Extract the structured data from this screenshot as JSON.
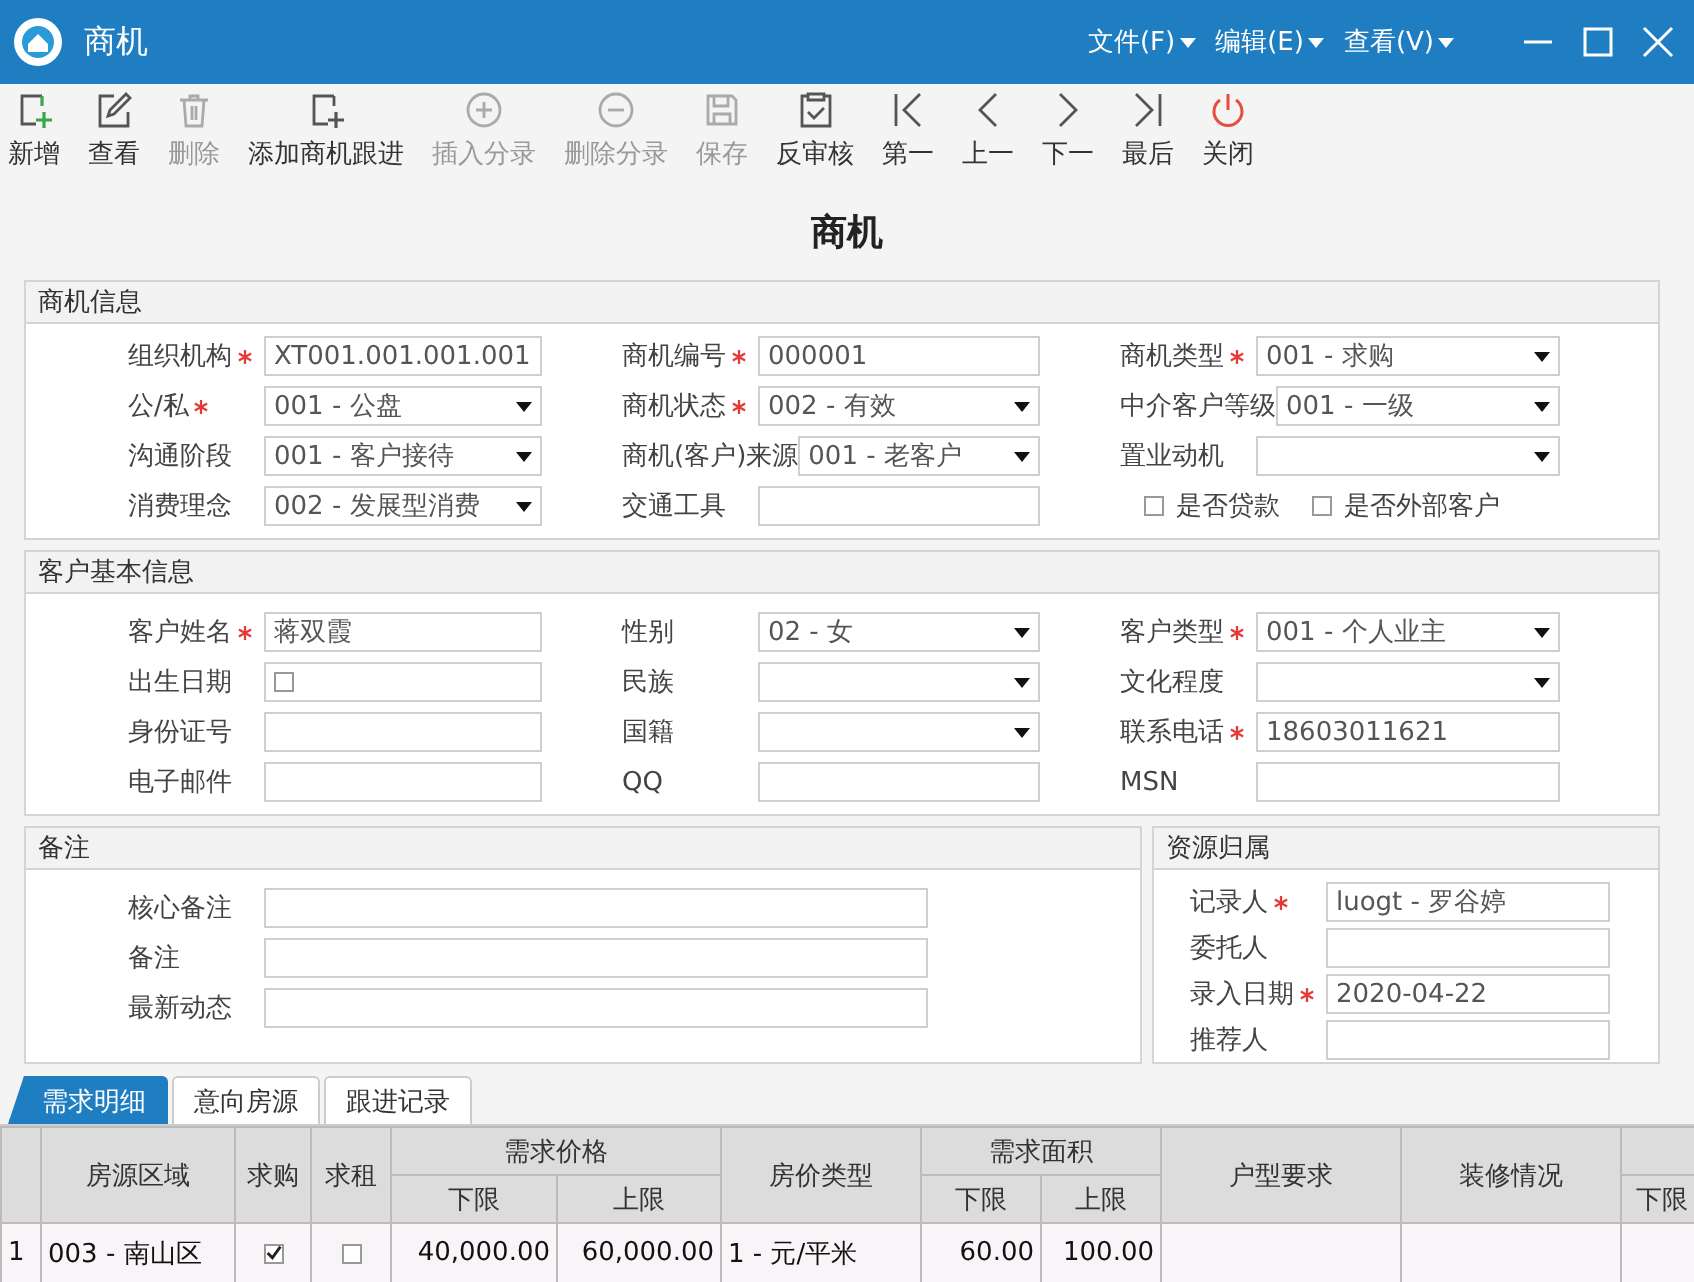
{
  "window": {
    "title": "商机",
    "menus": [
      "文件(F)",
      "编辑(E)",
      "查看(V)"
    ]
  },
  "toolbar": [
    {
      "label": "新增",
      "kind": "new",
      "disabled": false
    },
    {
      "label": "查看",
      "kind": "edit",
      "disabled": false
    },
    {
      "label": "删除",
      "kind": "delete",
      "disabled": true
    },
    {
      "label": "添加商机跟进",
      "kind": "add",
      "disabled": false
    },
    {
      "label": "插入分录",
      "kind": "insert",
      "disabled": true
    },
    {
      "label": "删除分录",
      "kind": "remove",
      "disabled": true
    },
    {
      "label": "保存",
      "kind": "save",
      "disabled": true
    },
    {
      "label": "反审核",
      "kind": "audit",
      "disabled": false
    },
    {
      "label": "第一",
      "kind": "first",
      "disabled": false
    },
    {
      "label": "上一",
      "kind": "prev",
      "disabled": false
    },
    {
      "label": "下一",
      "kind": "next",
      "disabled": false
    },
    {
      "label": "最后",
      "kind": "last",
      "disabled": false
    },
    {
      "label": "关闭",
      "kind": "close",
      "disabled": false
    }
  ],
  "heading": "商机",
  "sections": [
    {
      "title": "商机信息",
      "rows": [
        [
          {
            "kind": "text",
            "label": "组织机构",
            "required": true,
            "value": "XT001.001.001.001"
          },
          {
            "kind": "text",
            "label": "商机编号",
            "required": true,
            "value": "000001"
          },
          {
            "kind": "select",
            "label": "商机类型",
            "required": true,
            "value": "001 - 求购"
          }
        ],
        [
          {
            "kind": "select",
            "label": "公/私",
            "required": true,
            "value": "001 - 公盘"
          },
          {
            "kind": "select",
            "label": "商机状态",
            "required": true,
            "value": "002 - 有效"
          },
          {
            "kind": "select",
            "label": "中介客户等级",
            "required": false,
            "value": "001 - 一级"
          }
        ],
        [
          {
            "kind": "select",
            "label": "沟通阶段",
            "required": false,
            "value": "001 - 客户接待"
          },
          {
            "kind": "select",
            "label": "商机(客户)来源",
            "required": false,
            "value": "001 - 老客户"
          },
          {
            "kind": "select",
            "label": "置业动机",
            "required": false
          }
        ],
        [
          {
            "kind": "select",
            "label": "消费理念",
            "required": false,
            "value": "002 - 发展型消费"
          },
          {
            "kind": "text",
            "label": "交通工具",
            "required": false
          },
          {
            "kind": "checkgroup",
            "items": [
              {
                "label": "是否贷款",
                "checked": false
              },
              {
                "label": "是否外部客户",
                "checked": false
              }
            ]
          }
        ]
      ]
    },
    {
      "title": "客户基本信息",
      "rows": [
        [
          {
            "kind": "text",
            "label": "客户姓名",
            "required": true,
            "value": "蒋双霞"
          },
          {
            "kind": "select",
            "label": "性别",
            "required": false,
            "value": "02 - 女"
          },
          {
            "kind": "select",
            "label": "客户类型",
            "required": true,
            "value": "001 - 个人业主"
          }
        ],
        [
          {
            "kind": "date",
            "label": "出生日期",
            "required": false,
            "checked": false
          },
          {
            "kind": "select",
            "label": "民族",
            "required": false
          },
          {
            "kind": "select",
            "label": "文化程度",
            "required": false
          }
        ],
        [
          {
            "kind": "text",
            "label": "身份证号",
            "required": false
          },
          {
            "kind": "select",
            "label": "国籍",
            "required": false
          },
          {
            "kind": "text",
            "label": "联系电话",
            "required": true,
            "value": "18603011621"
          }
        ],
        [
          {
            "kind": "text",
            "label": "电子邮件",
            "required": false
          },
          {
            "kind": "text",
            "label": "QQ",
            "required": false
          },
          {
            "kind": "text",
            "label": "MSN",
            "required": false
          }
        ]
      ]
    },
    {
      "title": "备注",
      "rows": [
        [
          {
            "kind": "text",
            "label": "核心备注",
            "required": false
          }
        ],
        [
          {
            "kind": "text",
            "label": "备注",
            "required": false
          }
        ],
        [
          {
            "kind": "text",
            "label": "最新动态",
            "required": false
          }
        ]
      ]
    },
    {
      "title": "资源归属",
      "rows": [
        [
          {
            "kind": "text",
            "label": "记录人",
            "required": true,
            "value": "luogt  - 罗谷婷"
          }
        ],
        [
          {
            "kind": "text",
            "label": "委托人",
            "required": false
          }
        ],
        [
          {
            "kind": "text",
            "label": "录入日期",
            "required": true,
            "value": "2020-04-22"
          }
        ],
        [
          {
            "kind": "text",
            "label": "推荐人",
            "required": false
          }
        ]
      ]
    }
  ],
  "tabs": [
    {
      "label": "需求明细",
      "selected": true
    },
    {
      "label": "意向房源",
      "selected": false
    },
    {
      "label": "跟进记录",
      "selected": false
    }
  ],
  "table": {
    "columns": [
      {
        "label": "房源区域"
      },
      {
        "label": "求购"
      },
      {
        "label": "求租"
      },
      {
        "label": "下限",
        "group": "需求价格"
      },
      {
        "label": "上限",
        "grouped": true
      },
      {
        "label": "房价类型"
      },
      {
        "label": "下限",
        "group": "需求面积"
      },
      {
        "label": "上限",
        "grouped": true
      },
      {
        "label": "户型要求"
      },
      {
        "label": "装修情况"
      },
      {
        "label": "下限",
        "grouped": true
      }
    ],
    "rows": [
      {
        "number": "1",
        "cells": [
          {
            "kind": "text",
            "value": "003 - 南山区"
          },
          {
            "kind": "checkbox",
            "checked": true
          },
          {
            "kind": "checkbox",
            "checked": false
          },
          {
            "kind": "number",
            "value": "40,000.00"
          },
          {
            "kind": "number",
            "value": "60,000.00"
          },
          {
            "kind": "text",
            "value": "1 - 元/平米"
          },
          {
            "kind": "number",
            "value": "60.00"
          },
          {
            "kind": "number",
            "value": "100.00"
          }
        ]
      }
    ]
  }
}
